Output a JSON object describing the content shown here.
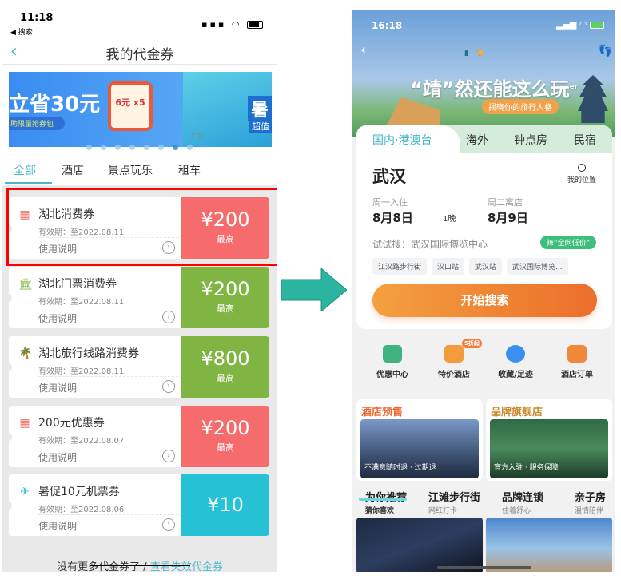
{
  "left_screen": {
    "status_bar": {
      "time": "11:18",
      "back_app": "◀ 搜索"
    },
    "header": {
      "back_icon": "‹",
      "title": "我的代金券"
    },
    "banner": {
      "headline": "立省30元",
      "subline": "助限量抢券包",
      "pack_label": "6元 x5",
      "second_title": "暑",
      "second_sub": "超值",
      "ad_label": "广告"
    },
    "tabs": [
      {
        "label": "全部",
        "active": true
      },
      {
        "label": "酒店"
      },
      {
        "label": "景点玩乐"
      },
      {
        "label": "租车"
      }
    ],
    "coupons": [
      {
        "name": "湖北消费券",
        "validity": "有效期：至2022.08.11",
        "usage": "使用说明",
        "amount": "¥200",
        "tag": "最高",
        "color": "#f66b6b",
        "icon": "hotel-icon",
        "highlighted": true
      },
      {
        "name": "湖北门票消费券",
        "validity": "有效期：至2022.08.11",
        "usage": "使用说明",
        "amount": "¥200",
        "tag": "最高",
        "color": "#80b544",
        "icon": "museum-icon"
      },
      {
        "name": "湖北旅行线路消费券",
        "validity": "有效期：至2022.08.11",
        "usage": "使用说明",
        "amount": "¥800",
        "tag": "最高",
        "color": "#80b544",
        "icon": "palm-tree-icon"
      },
      {
        "name": "200元优惠券",
        "validity": "有效期：至2022.08.07",
        "usage": "使用说明",
        "amount": "¥200",
        "tag": "最高",
        "color": "#f66b6b",
        "icon": "hotel-icon"
      },
      {
        "name": "暑促10元机票券",
        "validity": "有效期：至2022.08.06",
        "usage": "使用说明",
        "amount": "¥10",
        "tag": "",
        "color": "#25c1d4",
        "icon": "airplane-icon"
      }
    ],
    "footer": {
      "text": "没有更多代金券了 / ",
      "link": "查看失效代金券"
    },
    "accent": "#4bb8c8"
  },
  "arrow_color": "#2bb5a0",
  "right_screen": {
    "status_bar": {
      "time": "16:18"
    },
    "banner": {
      "slogan": "“靖”然还能这么玩",
      "slogan_sup": "er",
      "pill": "揭晓你的旅行人格"
    },
    "tabs": [
      {
        "label": "国内·港澳台",
        "active": true
      },
      {
        "label": "海外"
      },
      {
        "label": "钟点房"
      },
      {
        "label": "民宿"
      }
    ],
    "city": "武汉",
    "my_location": "我的位置",
    "checkin": {
      "label": "周一入住",
      "date": "8月8日"
    },
    "nights": "1晚",
    "checkout": {
      "label": "周二离店",
      "date": "8月9日"
    },
    "try_search": "试试搜：武汉国际博览中心",
    "lowest_badge": "筛“全网低价”",
    "chips": [
      "江汉路步行街",
      "汉口站",
      "武汉站",
      "武汉国际博览..."
    ],
    "search_button": "开始搜索",
    "quick_links": [
      {
        "label": "优惠中心",
        "icon": "coupon-icon",
        "color": "#3fb27f"
      },
      {
        "label": "特价酒店",
        "icon": "hotel-deal-icon",
        "color": "#f39a3c",
        "tag": "5折起"
      },
      {
        "label": "收藏/足迹",
        "icon": "star-icon",
        "color": "#3b8ff0"
      },
      {
        "label": "酒店订单",
        "icon": "order-icon",
        "color": "#f0883c"
      }
    ],
    "promos": [
      {
        "title": "酒店预售",
        "caption": "不满意随时退 · 过期退",
        "color": "#ee6b2f"
      },
      {
        "title": "品牌旗舰店",
        "caption": "官方入驻 · 服务保障",
        "color": "#c98a2e"
      }
    ],
    "rec_tabs": [
      {
        "label": "为你推荐",
        "sub": "猜你喜欢",
        "active": true
      },
      {
        "label": "江滩步行街",
        "sub": "网红打卡"
      },
      {
        "label": "品牌连锁",
        "sub": "住着舒心"
      },
      {
        "label": "亲子房",
        "sub": "温情陪伴"
      }
    ]
  }
}
